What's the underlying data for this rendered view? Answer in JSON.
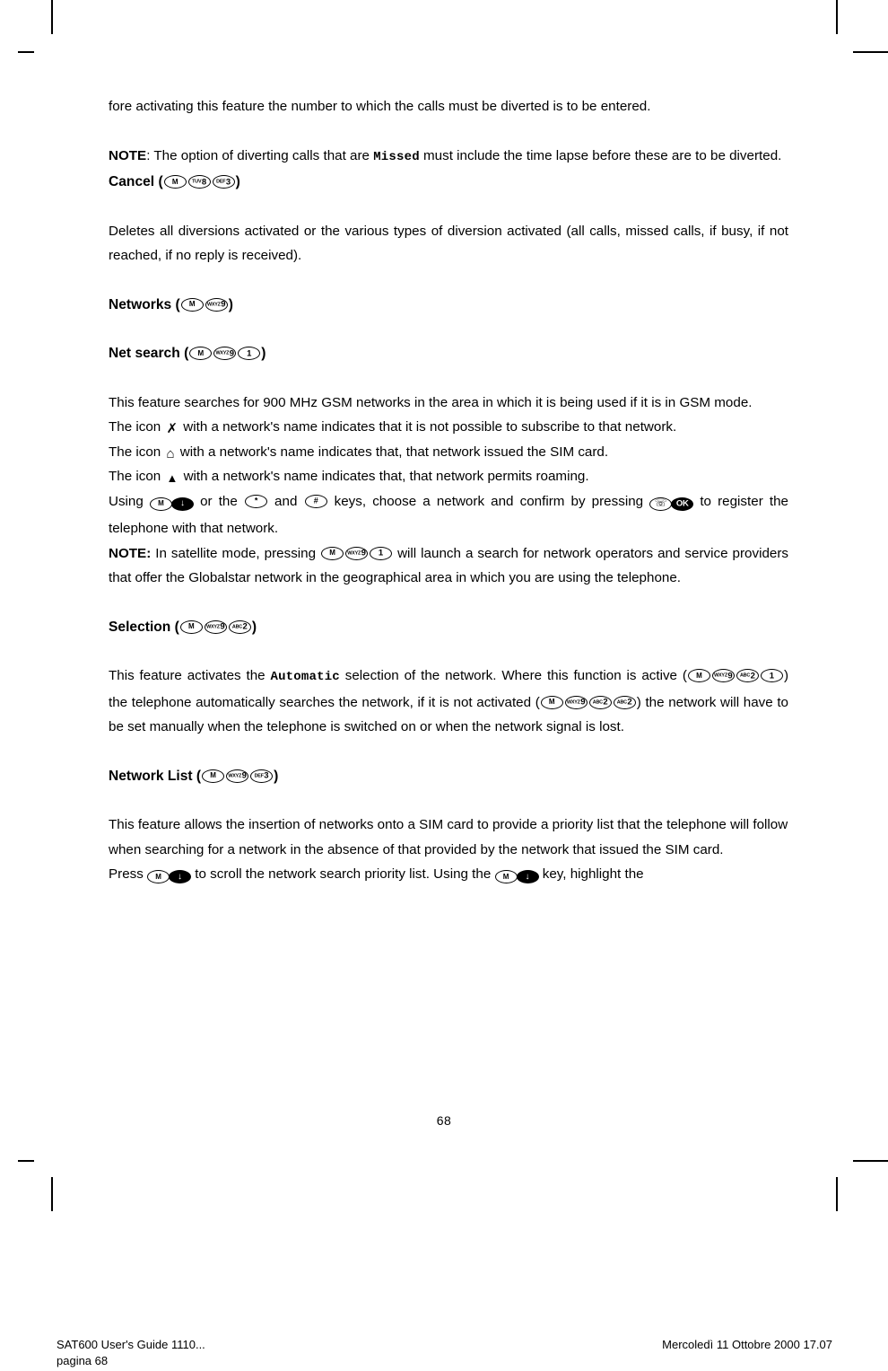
{
  "document": {
    "page_number": "68",
    "footer_left_line1": "SAT600 User's Guide 1110...",
    "footer_left_line2": "pagina 68",
    "footer_right": "Mercoledì 11 Ottobre 2000 17.07"
  },
  "keys": {
    "m": "M",
    "one": "1",
    "two_pre": "ABC",
    "two": "2",
    "three_pre": "DEF",
    "three": "3",
    "eight_pre": "TUV",
    "eight": "8",
    "nine_pre": "WXYZ",
    "nine": "9",
    "star": "* ",
    "hash": "#",
    "ok": "OK",
    "down_arrow": "↓",
    "phone": "☏"
  },
  "icons": {
    "no_subscribe": "✗",
    "home": "⌂",
    "roaming": "▲"
  },
  "content": {
    "p_intro": {
      "text": "fore activating this feature the number to which the calls must be diverted is to be entered."
    },
    "p_note_missed": {
      "label": "NOTE",
      "part1": ": The option of diverting calls that are ",
      "mono": "Missed",
      "part2": " must include the time lapse before these are to be diverted."
    },
    "h_cancel": {
      "title": "Cancel",
      "open": " (",
      "close": ")"
    },
    "p_deletes": {
      "text": "Deletes all diversions activated or the various types of diversion activated (all calls, missed calls, if busy, if not reached, if no reply is received)."
    },
    "h_networks": {
      "title": "Networks",
      "open": " (",
      "close": ")"
    },
    "h_net_search": {
      "title": "Net search",
      "open": " (",
      "close": ")"
    },
    "p_search_1": "This feature searches for 900 MHz GSM networks in the area in which it is being used if it is in GSM mode.",
    "p_icon_cross_a": "The icon ",
    "p_icon_cross_b": " with a network's name indicates that it is not possible to subscribe to that network.",
    "p_icon_home_a": "The icon ",
    "p_icon_home_b": " with a network's name indicates that, that network issued the SIM card.",
    "p_icon_tri_a": "The icon ",
    "p_icon_tri_b": " with a network's name indicates that, that network permits roaming.",
    "p_using_1": "Using ",
    "p_using_2": " or the ",
    "p_using_3": " and ",
    "p_using_4": " keys, choose a network and confirm by pressing ",
    "p_using_5": " to register the telephone with that network.",
    "p_note_sat_label": "NOTE:",
    "p_note_sat_1": " In satellite mode, pressing ",
    "p_note_sat_2": " will launch a search for network operators and service providers that offer the Globalstar network in the geographical area in which you are using the telephone.",
    "h_selection": {
      "title": "Selection",
      "open": " (",
      "close": ")"
    },
    "p_selection_1": "This feature activates the ",
    "p_selection_mono": "Automatic",
    "p_selection_2": " selection of the network. Where this function is active (",
    "p_selection_3": ") the telephone automatically searches the network, if it is not activated (",
    "p_selection_4": ") the network will have to be set manually when the telephone is switched on or when the network signal is lost.",
    "h_network_list": {
      "title": "Network List",
      "open": " (",
      "close": ")"
    },
    "p_netlist_1": "This feature allows the insertion of networks onto a SIM card to provide a priority list that the telephone will follow when searching for a network in the absence of that provided by the network that issued the SIM card.",
    "p_press_1": "Press ",
    "p_press_2": " to scroll the network search priority list. Using the ",
    "p_press_3": " key, highlight the"
  }
}
